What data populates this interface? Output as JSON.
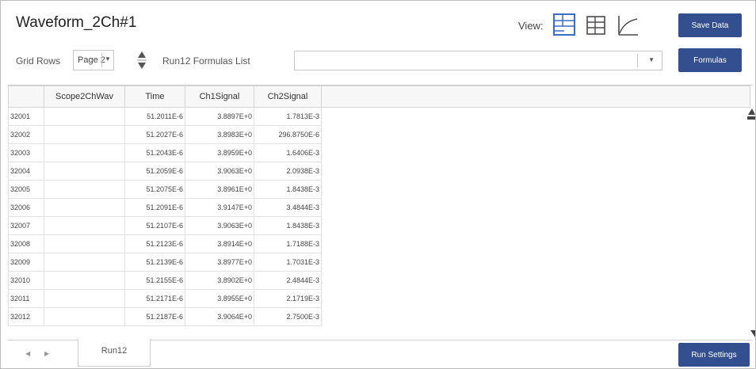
{
  "window": {
    "title": "Waveform_2Ch#1"
  },
  "view": {
    "label": "View:",
    "icons": [
      "notes-view-icon",
      "table-view-icon",
      "graph-view-icon"
    ],
    "active_color": "#3a6fbf"
  },
  "toolbar": {
    "save_label": "Save Data",
    "formulas_label": "Formulas",
    "run_settings_label": "Run Settings",
    "grid_rows_label": "Grid Rows",
    "page_value": "Page 2",
    "formulas_list_label": "Run12 Formulas List",
    "formulas_list_value": ""
  },
  "grid": {
    "columns": [
      "",
      "Scope2ChWav",
      "Time",
      "Ch1Signal",
      "Ch2Signal"
    ],
    "rows": [
      [
        "32001",
        "",
        "51.2011E-6",
        "3.8897E+0",
        "1.7813E-3"
      ],
      [
        "32002",
        "",
        "51.2027E-6",
        "3.8983E+0",
        "296.8750E-6"
      ],
      [
        "32003",
        "",
        "51.2043E-6",
        "3.8959E+0",
        "1.6406E-3"
      ],
      [
        "32004",
        "",
        "51.2059E-6",
        "3.9063E+0",
        "2.0938E-3"
      ],
      [
        "32005",
        "",
        "51.2075E-6",
        "3.8961E+0",
        "1.8438E-3"
      ],
      [
        "32006",
        "",
        "51.2091E-6",
        "3.9147E+0",
        "3.4844E-3"
      ],
      [
        "32007",
        "",
        "51.2107E-6",
        "3.9063E+0",
        "1.8438E-3"
      ],
      [
        "32008",
        "",
        "51.2123E-6",
        "3.8914E+0",
        "1.7188E-3"
      ],
      [
        "32009",
        "",
        "51.2139E-6",
        "3.8977E+0",
        "1.7031E-3"
      ],
      [
        "32010",
        "",
        "51.2155E-6",
        "3.8902E+0",
        "2.4844E-3"
      ],
      [
        "32011",
        "",
        "51.2171E-6",
        "3.8955E+0",
        "2.1719E-3"
      ],
      [
        "32012",
        "",
        "51.2187E-6",
        "3.9064E+0",
        "2.7500E-3"
      ]
    ]
  },
  "tabs": [
    {
      "label": "Run12"
    }
  ],
  "colors": {
    "button_bg": "#344f8f",
    "accent": "#3a6fbf"
  }
}
